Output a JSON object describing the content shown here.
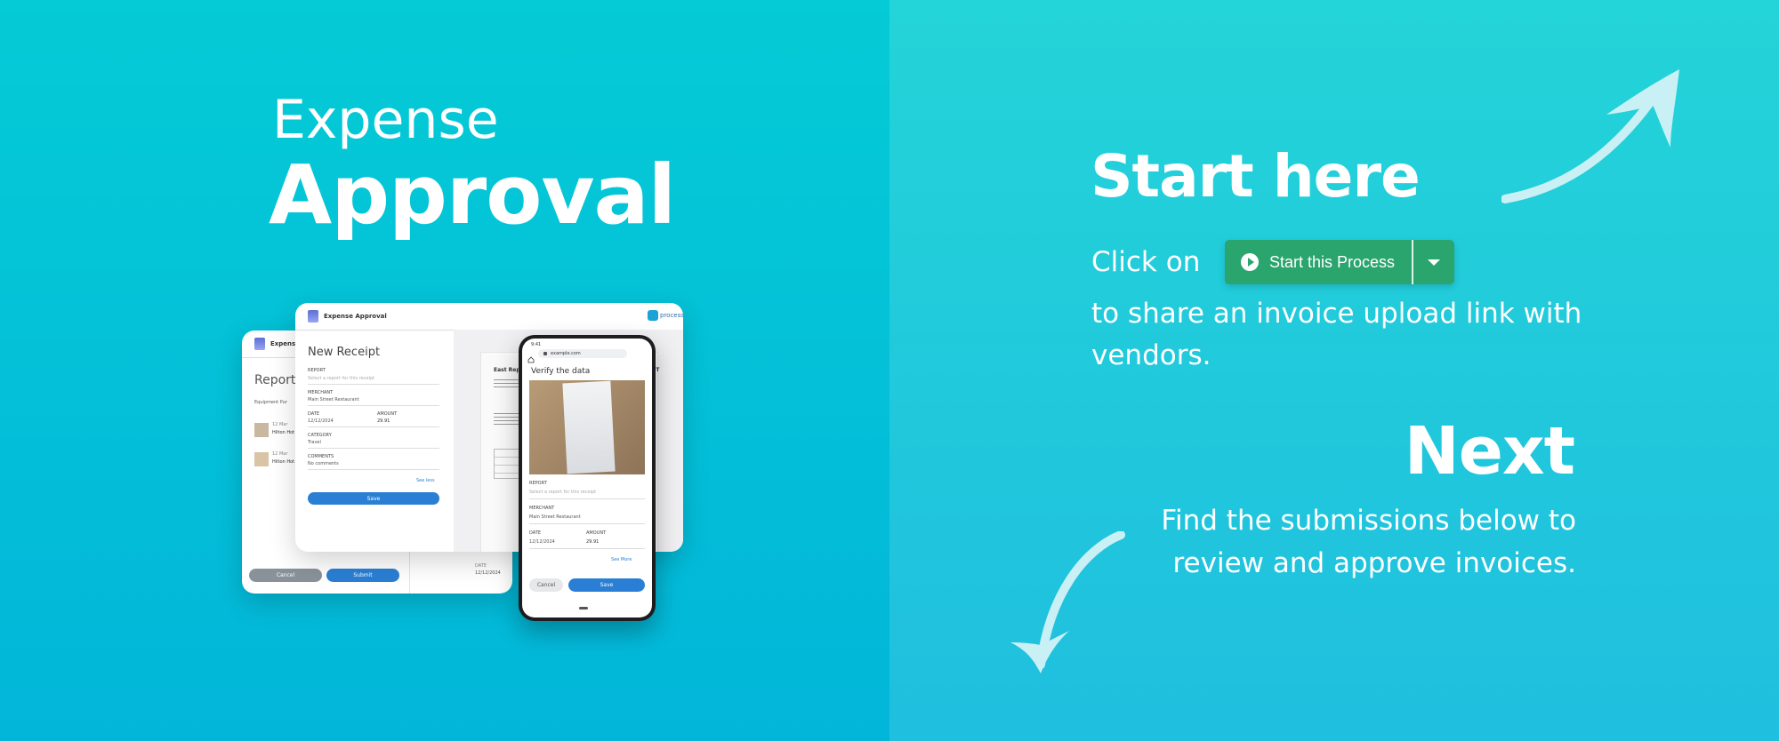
{
  "hero": {
    "line1": "Expense",
    "line2": "Approval"
  },
  "front_card": {
    "app_title": "Expense Approval",
    "brand": "process",
    "heading": "New Receipt",
    "report_label": "REPORT",
    "report_placeholder": "Select a report for this receipt",
    "merchant_label": "MERCHANT",
    "merchant_value": "Main Street Restaurant",
    "date_label": "DATE",
    "date_value": "12/12/2024",
    "amount_label": "AMOUNT",
    "amount_value": "29.91",
    "category_label": "CATEGORY",
    "category_value": "Travel",
    "comments_label": "COMMENTS",
    "comments_value": "No comments",
    "see_less": "See less",
    "save": "Save",
    "doc_title": "East Rep",
    "doc_right": "PT"
  },
  "back_card": {
    "app_title": "Expens",
    "heading": "Report",
    "sub": "Equipment Pur",
    "row1_date": "12 Mar",
    "row1_text": "Hilton Hot",
    "row2_date": "12 Mar",
    "row2_text": "Hilton Hot",
    "date_label": "DATE",
    "date_value": "12/12/2024",
    "cancel": "Cancel",
    "submit": "Submit"
  },
  "phone": {
    "time": "9:41",
    "url": "example.com",
    "heading": "Verify the data",
    "report_label": "REPORT",
    "report_placeholder": "Select a report for this receipt",
    "merchant_label": "MERCHANT",
    "merchant_value": "Main Street Restaurant",
    "date_label": "DATE",
    "date_value": "12/12/2024",
    "amount_label": "AMOUNT",
    "amount_value": "29.91",
    "see_more": "See More",
    "cancel": "Cancel",
    "save": "Save"
  },
  "right": {
    "start_title": "Start here",
    "click_on": "Click on",
    "button_label": "Start this Process",
    "share_text": "to share an invoice upload link with vendors.",
    "next_title": "Next",
    "find_text": "Find the submissions below to review and approve invoices."
  },
  "colors": {
    "left_bg": "#05cbd6",
    "right_bg": "#23d4d8",
    "button_green": "#2aa56e",
    "primary_blue": "#2a7fd4"
  },
  "icons": [
    "play-icon",
    "caret-down-icon",
    "arrow-up-right-icon",
    "arrow-down-left-icon",
    "lock-icon",
    "home-icon"
  ]
}
